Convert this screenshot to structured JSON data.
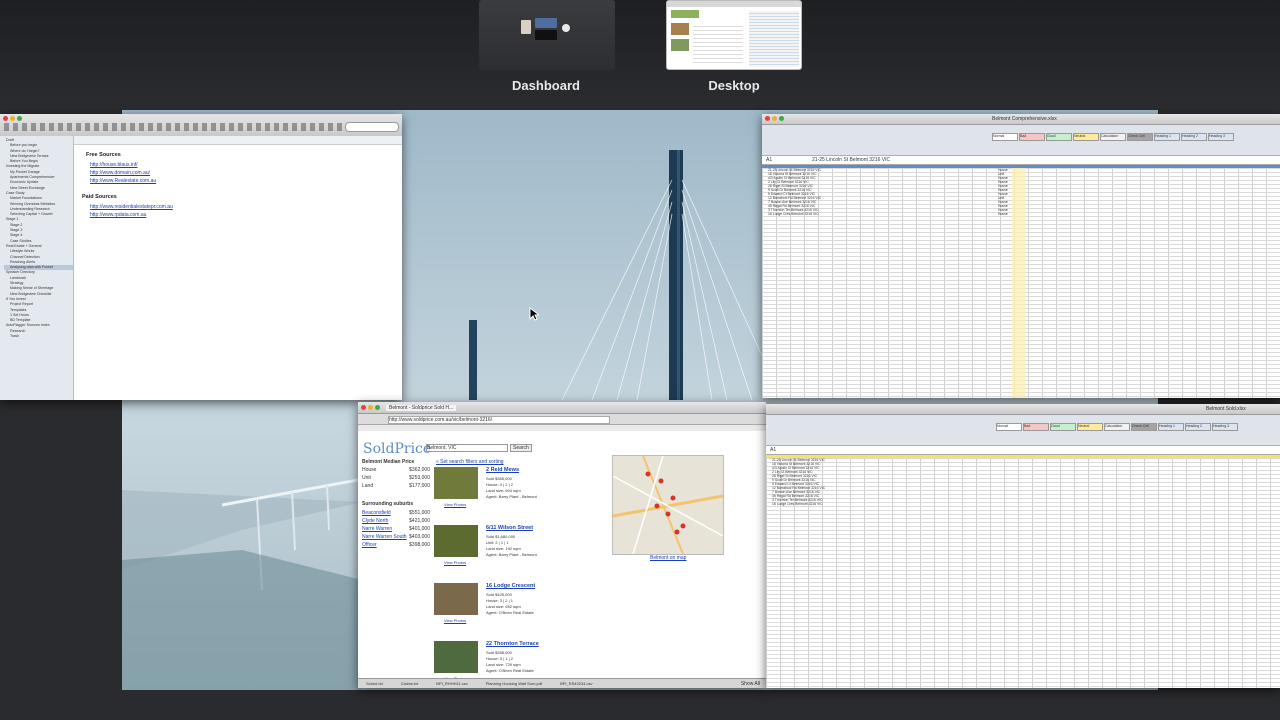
{
  "spaces": {
    "dashboard_label": "Dashboard",
    "desktop_label": "Desktop"
  },
  "scrivener": {
    "section_free_title": "Free Sources",
    "free_links": [
      "http://house.blaus.inf/",
      "http://www.domain.com.au/",
      "http://www.Realestate.com.au"
    ],
    "section_paid_title": "Paid Sources",
    "paid_links": [
      "http://www.residentialestatepr.com.au",
      "http://www.rpdata.com.au"
    ],
    "binder_items": [
      "Draft",
      "Before you begin",
      "Where do I begin?",
      "New Bridgeview Terrace",
      "Before You Begin",
      "Investing the Migrate",
      "My Pocket Garage",
      "Apartments Comprehensive",
      "Economic Update",
      "New Street Exchange",
      "Case Study",
      "Market Foundations",
      "Winning Overseas Websites",
      "Understanding Research",
      "Selecting Capital + Growth",
      "Stage 1",
      "Stage 2",
      "Stage 3",
      "Stage 4",
      "Case Studies",
      "Real Estate + General",
      "Lifestyle Works",
      "Channel Detection",
      "Reaching Alerts",
      "Analysing data with Pocket",
      "Speaker Directory",
      "Landmark",
      "Strategy",
      "Making Sense of Streetage",
      "New Bridgeview Checklist",
      "If You Invest",
      "Project Report",
      "Templates",
      "1 Set Hours",
      "BD Template",
      "AutoFlagger Sources Index",
      "Research",
      "Trash"
    ]
  },
  "soldprice": {
    "browser_title": "Belmont - Soldprice Sold H...",
    "address": "http://www.soldprice.com.au/vic/belmont-3216/",
    "logo_text": "SoldPrice",
    "search_value": "Belmont, VIC",
    "search_button": "Search",
    "back_link": "« Set search filters and sorting",
    "median_title": "Belmont Median Price",
    "median_rows": [
      {
        "label": "House",
        "value": "$362,000"
      },
      {
        "label": "Unit",
        "value": "$253,000"
      },
      {
        "label": "Land",
        "value": "$177,000"
      }
    ],
    "surrounding_title": "Surrounding suburbs",
    "surrounding_rows": [
      {
        "label": "Beaconsfield",
        "value": "$551,000"
      },
      {
        "label": "Clyde North",
        "value": "$421,000"
      },
      {
        "label": "Narre Warren",
        "value": "$401,000"
      },
      {
        "label": "Narre Warren South",
        "value": "$403,000"
      },
      {
        "label": "Officer",
        "value": "$398,000"
      }
    ],
    "listings": [
      {
        "title": "2 Reid Mews",
        "sold": "Sold $355,000",
        "beds": "House: 3 | 2 | 2",
        "land": "Land size: 604 sqm",
        "agent": "Agent: Barry Plant - Belmont"
      },
      {
        "title": "6/11 Wilson Street",
        "sold": "Sold $1,680,000",
        "beds": "Unit: 2 | 1 | 1",
        "land": "Land size: 192 sqm",
        "agent": "Agent: Barry Plant - Belmont"
      },
      {
        "title": "16 Lodge Crescent",
        "sold": "Sold $425,000",
        "beds": "House: 3 | 2 | 1",
        "land": "Land size: 692 sqm",
        "agent": "Agent: O'Brien Real Estate"
      },
      {
        "title": "22 Thornton Terrace",
        "sold": "Sold $398,000",
        "beds": "House: 3 | 1 | 2",
        "land": "Land size: 729 sqm",
        "agent": "Agent: O'Brien Real Estate"
      }
    ],
    "view_photos": "View Photos",
    "map_link": "Belmont on map",
    "downloads": [
      "Sched.txt",
      "Claims.txt",
      "BPI_RHHH11.csv",
      "Planning Housing Wait Sum.pdf",
      "BPI_RS43234.csv"
    ],
    "show_all": "Show All"
  },
  "excel_top": {
    "title": "Belmont Comprehensive.xlsx",
    "cell_ref": "A1",
    "formula": "21-25 Lincoln St Belmont 3216 VIC",
    "styles": [
      "Normal",
      "Bad",
      "Good",
      "Neutral",
      "Calculation",
      "Check Cell",
      "Heading 1",
      "Heading 2",
      "Heading 3"
    ],
    "addresses": [
      "21-25 Lincoln St Belmont 3216 VIC",
      "18 Victoria St Belmont 3216 VIC",
      "4/3 Apollo Ct Belmont 3216 VIC",
      "2 Lily Ct Belmont 3216 VIC",
      "28 Rigel St Belmont 3216 VIC",
      "9 Scott Dr Belmont 3216 VIC",
      "5 Edward Ct Belmont 3216 VIC",
      "12 Barrabool Rd Belmont 3216 VIC",
      "7 Boston Ave Belmont 3216 VIC",
      "45 Regal Rd Belmont 3216 VIC",
      "3 Thornton Ter Belmont 3216 VIC",
      "16 Lodge Cres Belmont 3216 VIC"
    ],
    "types": [
      "House",
      "Unit",
      "House",
      "House",
      "House",
      "House",
      "House",
      "Unit",
      "House",
      "House",
      "House",
      "House"
    ]
  },
  "excel_bottom": {
    "title": "Belmont Sold.xlsx",
    "cell_ref": "A1"
  }
}
